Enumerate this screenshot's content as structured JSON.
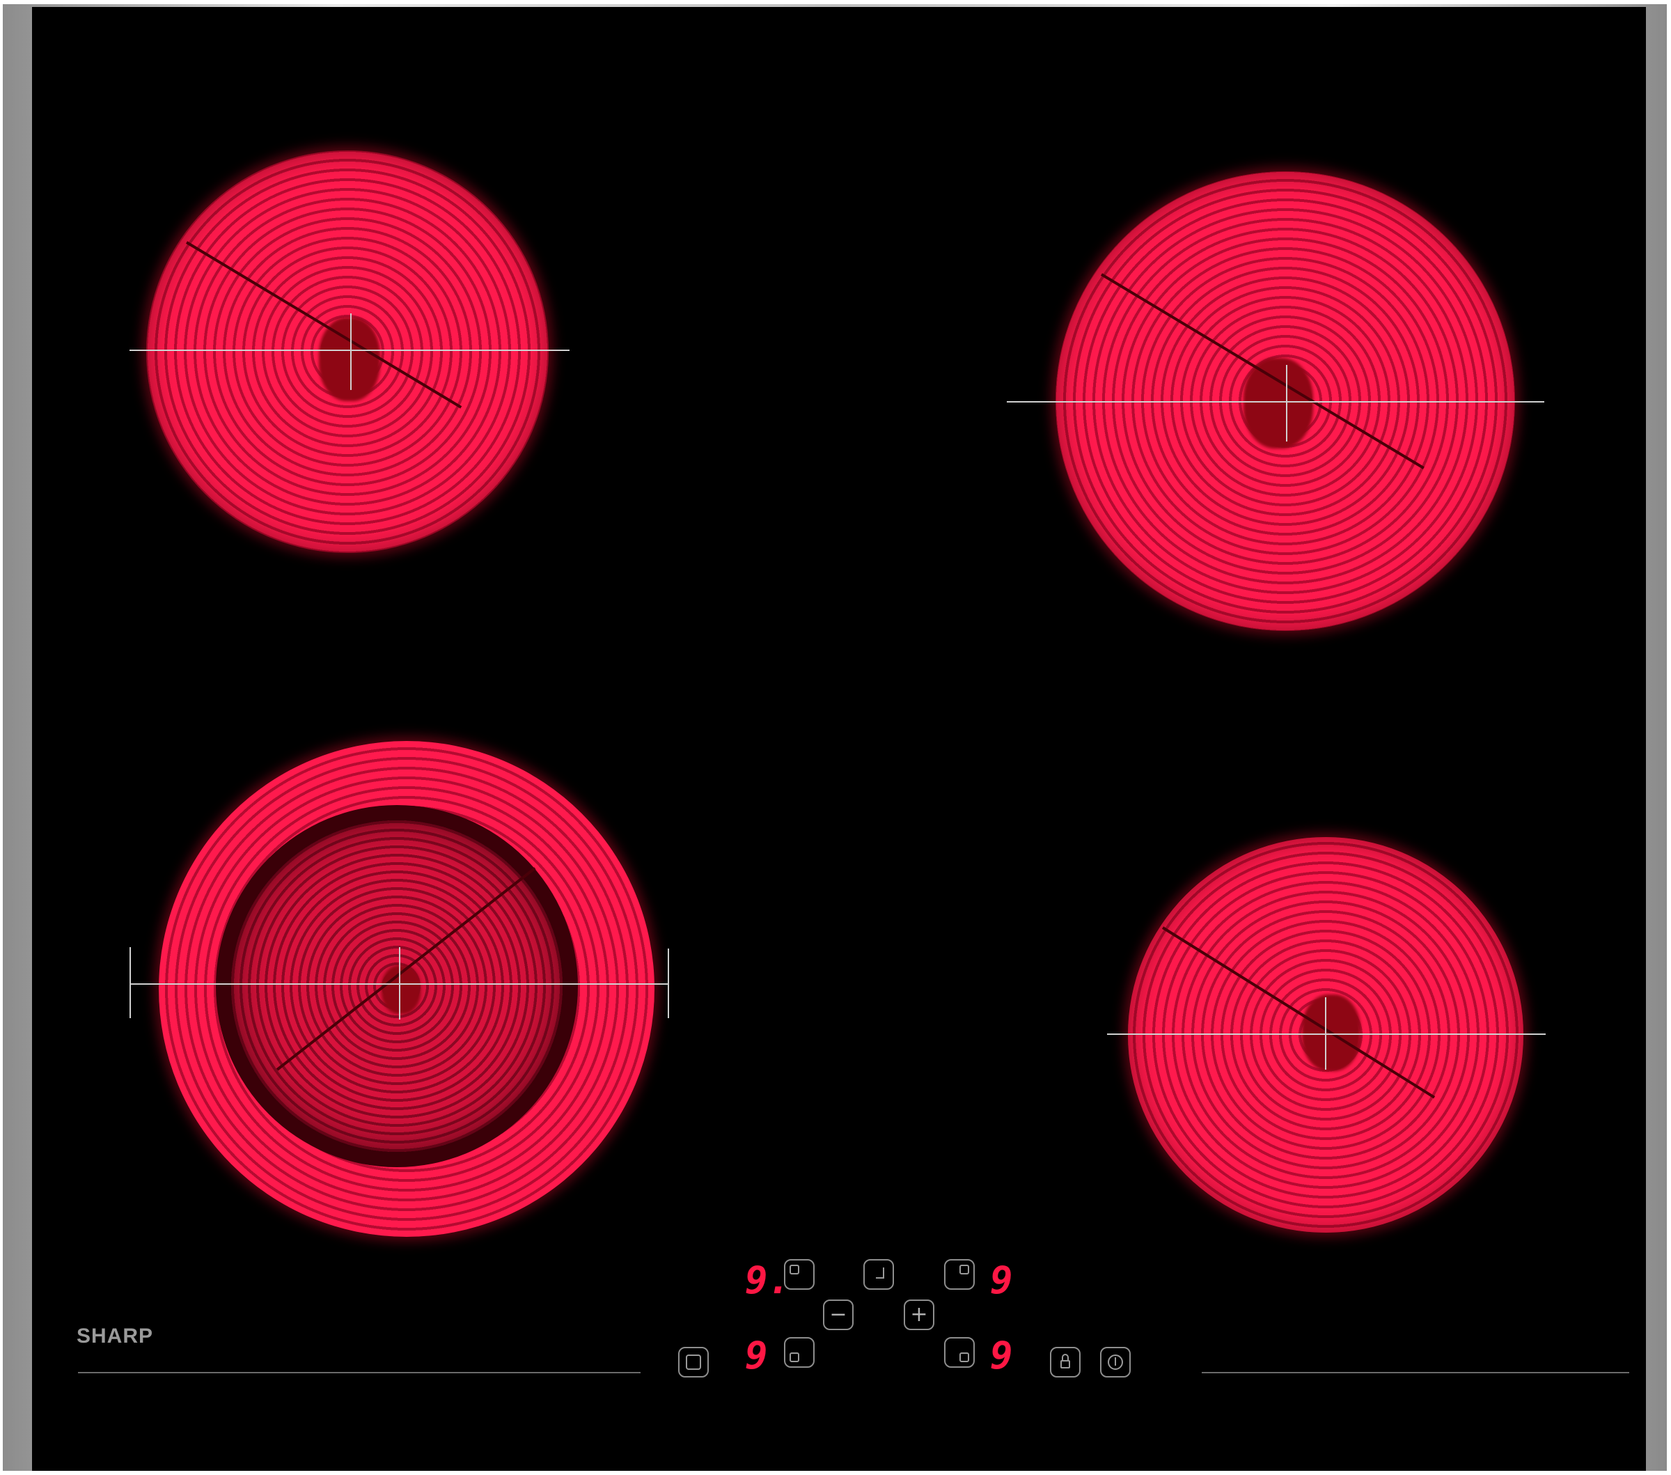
{
  "brand": {
    "name": "SHARP"
  },
  "zones": [
    {
      "name": "rear-left-zone",
      "type": "single"
    },
    {
      "name": "rear-right-zone",
      "type": "single"
    },
    {
      "name": "front-left-zone",
      "type": "dual"
    },
    {
      "name": "front-right-zone",
      "type": "single"
    }
  ],
  "controls": {
    "display_rear_left": "9.",
    "display_rear_right": "9",
    "display_front_left": "9",
    "display_front_right": "9",
    "minus_label": "−",
    "plus_label": "+",
    "icons": {
      "rear_left_select": "zone-rear-left-icon",
      "timer": "timer-icon",
      "rear_right_select": "zone-rear-right-icon",
      "front_left_select": "zone-front-left-icon",
      "front_right_select": "zone-front-right-icon",
      "dual_zone": "dual-zone-icon",
      "lock": "lock-icon",
      "power": "power-icon"
    }
  }
}
